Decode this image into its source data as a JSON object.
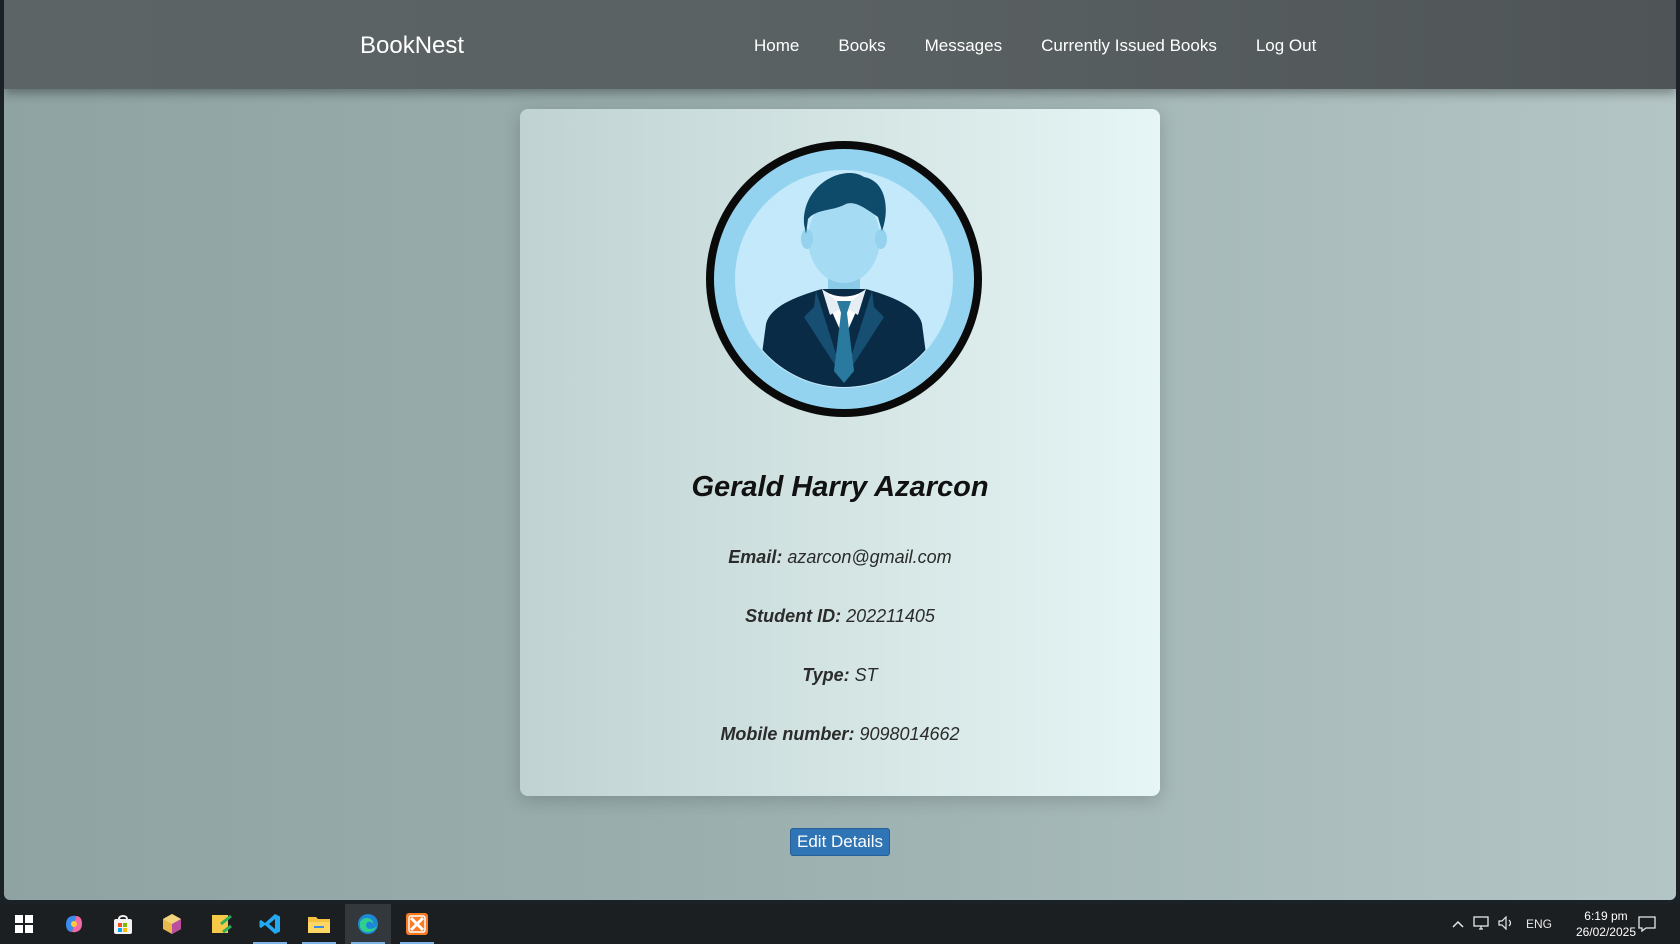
{
  "navbar": {
    "brand": "BookNest",
    "links": [
      "Home",
      "Books",
      "Messages",
      "Currently Issued Books",
      "Log Out"
    ]
  },
  "profile": {
    "name": "Gerald Harry Azarcon",
    "email_label": "Email:",
    "email": "azarcon@gmail.com",
    "student_id_label": "Student ID:",
    "student_id": "202211405",
    "type_label": "Type:",
    "type": "ST",
    "mobile_label": "Mobile number:",
    "mobile": "9098014662"
  },
  "edit_button": "Edit Details",
  "taskbar": {
    "icons": [
      "windows-start-icon",
      "copilot-icon",
      "store-icon",
      "package-icon",
      "sticky-app-icon",
      "vscode-icon",
      "file-explorer-icon",
      "edge-icon",
      "xampp-icon"
    ],
    "language": "ENG",
    "time": "6:19 pm",
    "date": "26/02/2025"
  },
  "colors": {
    "navbar": "#5a6163",
    "card": "#d5e6e5",
    "button": "#2f74b5",
    "avatar_ring": "#0a0a0a",
    "avatar_bg": "#93d3ef"
  }
}
